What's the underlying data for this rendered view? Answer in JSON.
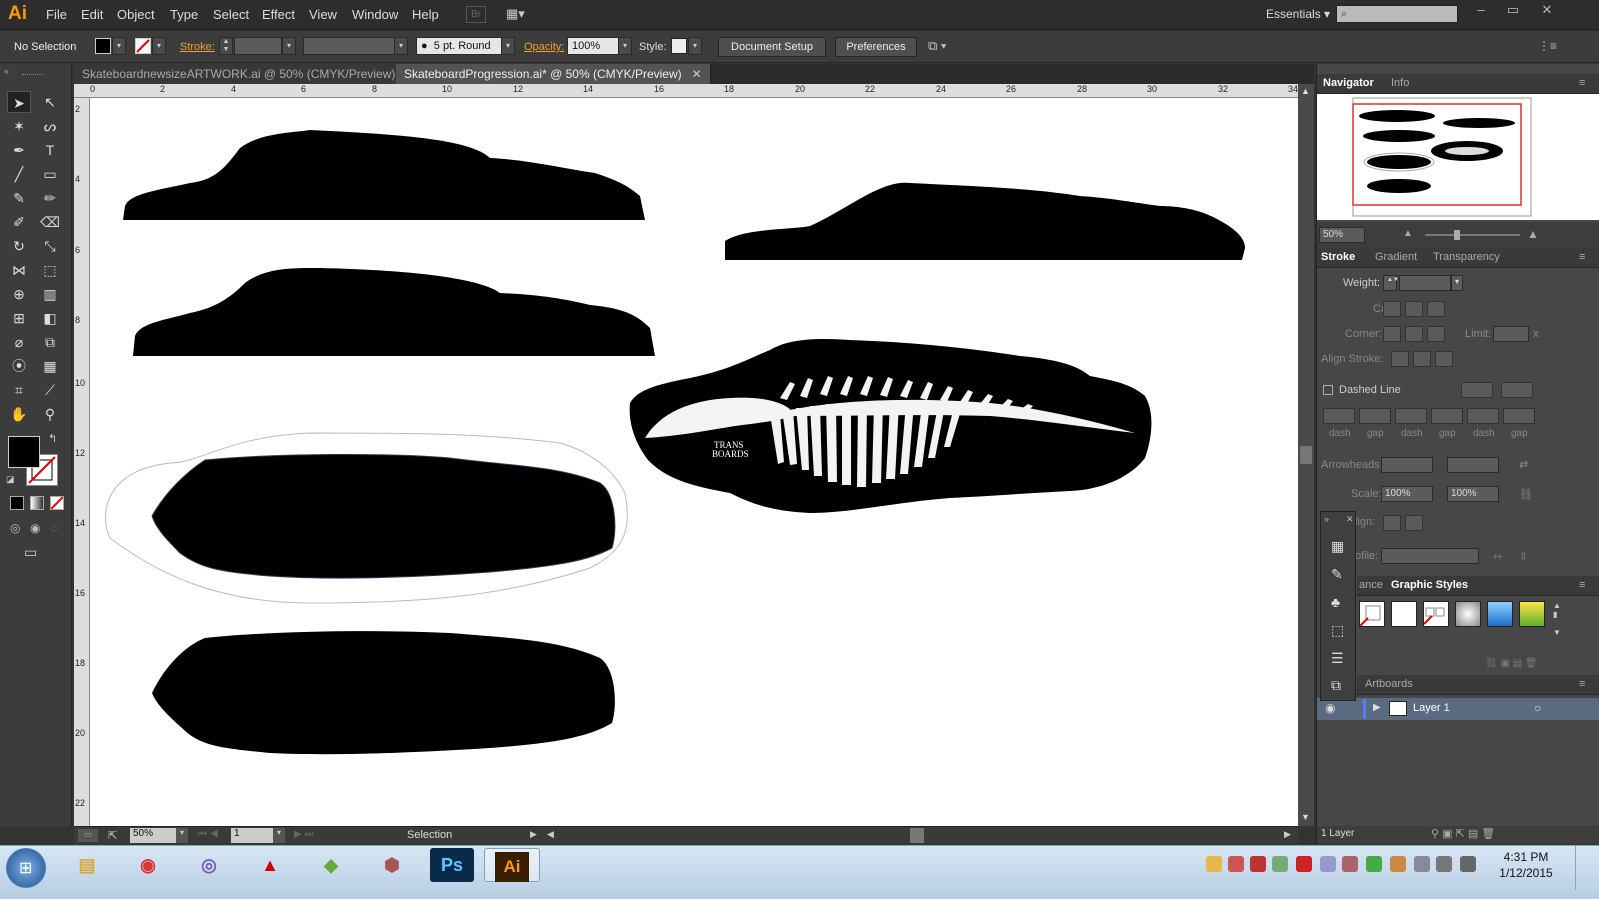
{
  "app": {
    "logo": "Ai"
  },
  "menu": [
    "File",
    "Edit",
    "Object",
    "Type",
    "Select",
    "Effect",
    "View",
    "Window",
    "Help"
  ],
  "bridge_label": "Br",
  "workspace": "Essentials",
  "control": {
    "selection": "No Selection",
    "stroke_label": "Stroke:",
    "brush": "5 pt. Round",
    "opacity_label": "Opacity:",
    "opacity": "100%",
    "style_label": "Style:",
    "doc_setup": "Document Setup",
    "preferences": "Preferences"
  },
  "tabs": [
    {
      "label": "SkateboardnewsizeARTWORK.ai @ 50% (CMYK/Preview)",
      "active": false
    },
    {
      "label": "SkateboardProgression.ai* @ 50% (CMYK/Preview)",
      "active": true
    }
  ],
  "ruler_h": [
    "0",
    "2",
    "4",
    "6",
    "8",
    "10",
    "12",
    "14",
    "16",
    "18",
    "20",
    "22",
    "24",
    "26",
    "28",
    "30",
    "32",
    "34"
  ],
  "ruler_v": [
    "2",
    "4",
    "6",
    "8",
    "10",
    "12",
    "14",
    "16",
    "18",
    "20",
    "22"
  ],
  "artwork_text": {
    "line1": "TRANS",
    "line2": "BOARDS"
  },
  "status": {
    "zoom": "50%",
    "page": "1",
    "tool": "Selection"
  },
  "navigator": {
    "tabs": [
      "Navigator",
      "Info"
    ],
    "zoom": "50%"
  },
  "stroke_panel": {
    "tabs": [
      "Stroke",
      "Gradient",
      "Transparency"
    ],
    "weight": "Weight:",
    "cap": "Cap:",
    "corner": "Corner:",
    "limit": "Limit:",
    "limit_x": "x",
    "align": "Align Stroke:",
    "dashed": "Dashed Line",
    "dash_labels": [
      "dash",
      "gap",
      "dash",
      "gap",
      "dash",
      "gap"
    ],
    "arrowheads": "Arrowheads:",
    "scale": "Scale:",
    "scale1": "100%",
    "scale2": "100%",
    "align2": "lign:",
    "profile": "ofile:"
  },
  "styles_panel": {
    "tabs": [
      "ance",
      "Graphic Styles"
    ]
  },
  "layers_panel": {
    "tab": "Artboards",
    "layer_name": "Layer 1",
    "count": "1 Layer"
  },
  "taskbar": {
    "apps": [
      {
        "name": "explorer",
        "glyph": "▤",
        "color": "#d9a93a"
      },
      {
        "name": "chrome",
        "glyph": "◉",
        "color": "#d33"
      },
      {
        "name": "firefox",
        "glyph": "◎",
        "color": "#7a5ab8"
      },
      {
        "name": "autocad",
        "glyph": "▲",
        "color": "#c00"
      },
      {
        "name": "sketchup",
        "glyph": "◆",
        "color": "#6a3"
      },
      {
        "name": "3d-app",
        "glyph": "⬢",
        "color": "#a55"
      },
      {
        "name": "photoshop",
        "glyph": "Ps",
        "color": "#5cc8ff"
      },
      {
        "name": "illustrator",
        "glyph": "Ai",
        "color": "#ff9a00"
      }
    ],
    "time": "4:31 PM",
    "date": "1/12/2015"
  }
}
